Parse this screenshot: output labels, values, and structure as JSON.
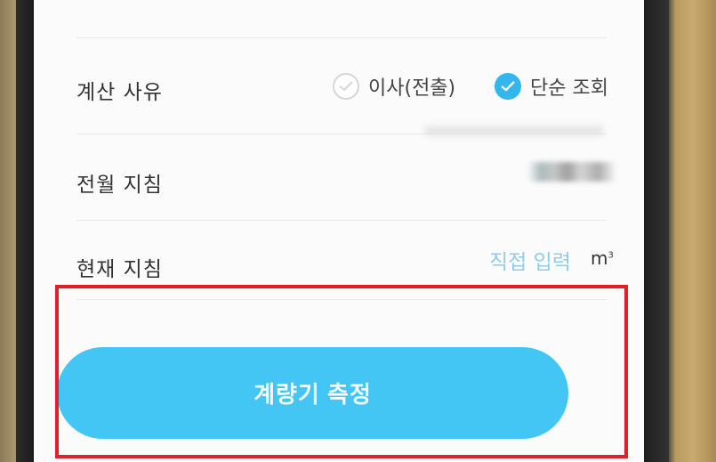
{
  "reason": {
    "label": "계산 사유",
    "options": [
      {
        "label": "이사(전출)",
        "selected": false
      },
      {
        "label": "단순 조회",
        "selected": true
      }
    ]
  },
  "previous_reading": {
    "label": "전월 지침"
  },
  "current_reading": {
    "label": "현재 지침",
    "input_placeholder": "직접 입력",
    "unit": "m",
    "unit_sup": "3"
  },
  "measure_button": {
    "label": "계량기 측정"
  },
  "colors": {
    "accent": "#44c6f4",
    "radio_selected": "#33b6ee",
    "placeholder": "#8fcdf0",
    "highlight": "#e0202a"
  }
}
